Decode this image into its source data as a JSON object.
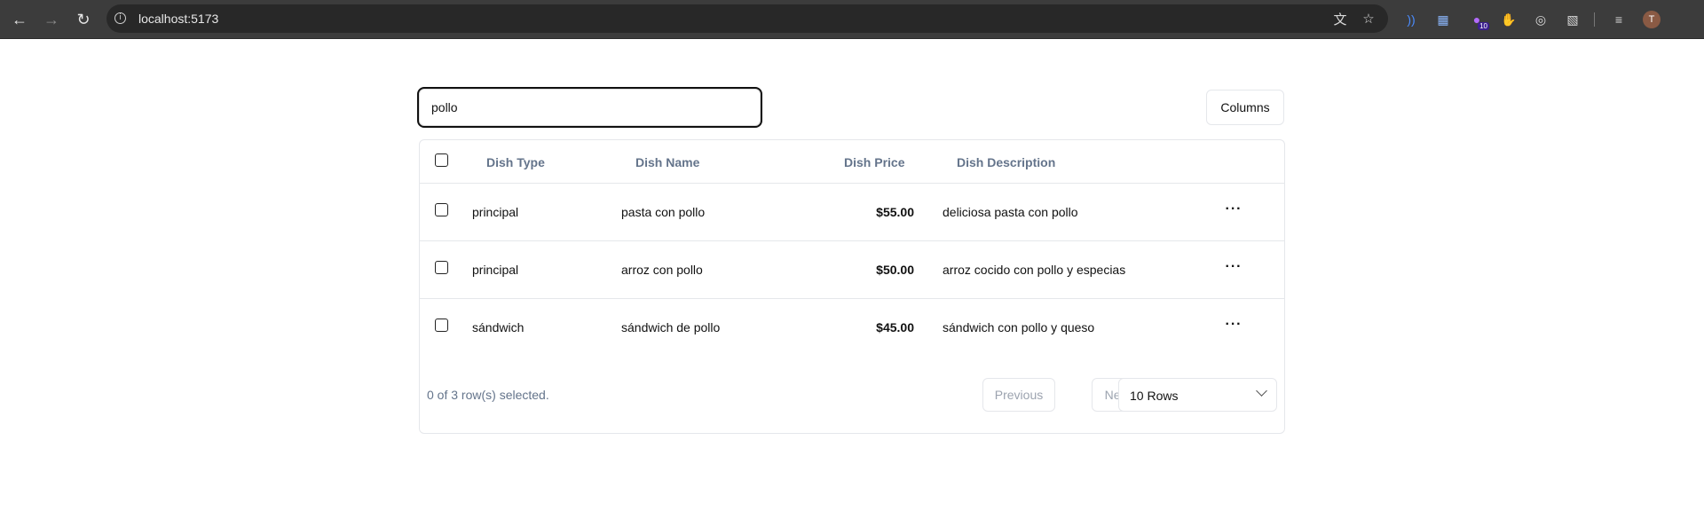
{
  "browser": {
    "url": "localhost:5173",
    "avatar_initial": "T",
    "extension_badge": "10"
  },
  "search": {
    "value": "pollo"
  },
  "columns_button": "Columns",
  "table": {
    "headers": {
      "type": "Dish Type",
      "name": "Dish Name",
      "price": "Dish Price",
      "description": "Dish Description"
    },
    "rows": [
      {
        "type": "principal",
        "name": "pasta con pollo",
        "price": "$55.00",
        "description": "deliciosa pasta con pollo"
      },
      {
        "type": "principal",
        "name": "arroz con pollo",
        "price": "$50.00",
        "description": "arroz cocido con pollo y especias"
      },
      {
        "type": "sándwich",
        "name": "sándwich de pollo",
        "price": "$45.00",
        "description": "sándwich con pollo y queso"
      }
    ],
    "row_actions_icon": "···"
  },
  "footer": {
    "selection_text": "0 of 3 row(s) selected.",
    "previous": "Previous",
    "next": "Next",
    "rows_per_page": "10 Rows"
  }
}
